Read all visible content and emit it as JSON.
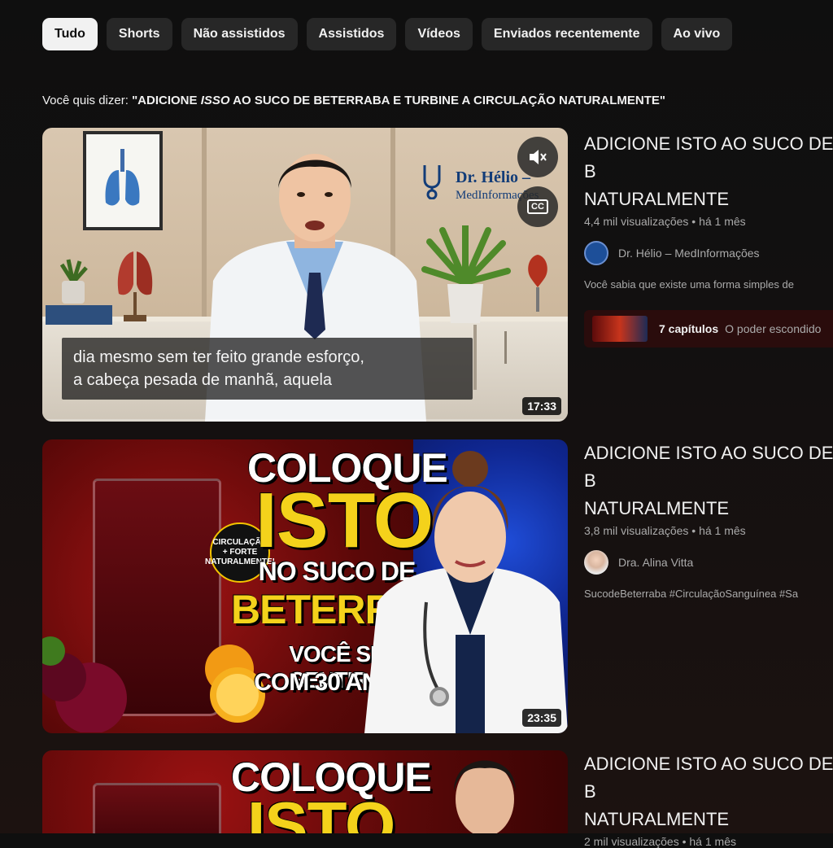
{
  "filters": [
    {
      "label": "Tudo",
      "active": true
    },
    {
      "label": "Shorts"
    },
    {
      "label": "Não assistidos"
    },
    {
      "label": "Assistidos"
    },
    {
      "label": "Vídeos"
    },
    {
      "label": "Enviados recentemente"
    },
    {
      "label": "Ao vivo"
    }
  ],
  "did_you_mean": {
    "prefix": "Você quis dizer: ",
    "query_part1": "\"ADICIONE ",
    "query_italic": "ISSO",
    "query_part2": " AO SUCO DE BETERRABA E TURBINE A CIRCULAÇÃO NATURALMENTE\""
  },
  "videos": [
    {
      "title": "ADICIONE ISTO AO SUCO DE B\nNATURALMENTE",
      "views": "4,4 mil visualizações • há 1 mês",
      "channel": "Dr. Hélio – MedInformações",
      "description": "Você sabia que existe uma forma simples de",
      "duration": "17:33",
      "chapters_count": "7 capítulos",
      "chapters_title": "O poder escondido",
      "thumb_logo_line1": "Dr. Hélio –",
      "thumb_logo_line2": "MedInformações",
      "caption_line1": "dia mesmo sem ter feito grande esforço,",
      "caption_line2": "a cabeça pesada de manhã, aquela",
      "cc_label": "CC"
    },
    {
      "title": "ADICIONE ISTO AO SUCO DE B\nNATURALMENTE",
      "views": "3,8 mil visualizações • há 1 mês",
      "channel": "Dra. Alina Vitta",
      "description": "SucodeBeterraba #CirculaçãoSanguínea #Sa",
      "duration": "23:35",
      "thumb_line1": "COLOQUE",
      "thumb_line2": "ISTO",
      "thumb_line3": "NO SUCO DE",
      "thumb_line4": "BETERRABA!",
      "thumb_line5": "VOCÊ SE SENTIRÁ",
      "thumb_line6": "COM 30 ANOS!",
      "badge": "CIRCULAÇÃO\n+ FORTE\nNATURALMENTE!"
    },
    {
      "title": "ADICIONE ISTO AO SUCO DE B\nNATURALMENTE",
      "views": "2 mil visualizações • há 1 mês",
      "thumb_line1": "COLOQUE",
      "thumb_line2": "ISTO"
    }
  ],
  "colors": {
    "background": "#0f0f0f",
    "chip_bg": "#272727",
    "chip_active_bg": "#f1f1f1",
    "secondary_text": "#aaaaaa",
    "headline_yellow": "#f4d21b"
  }
}
